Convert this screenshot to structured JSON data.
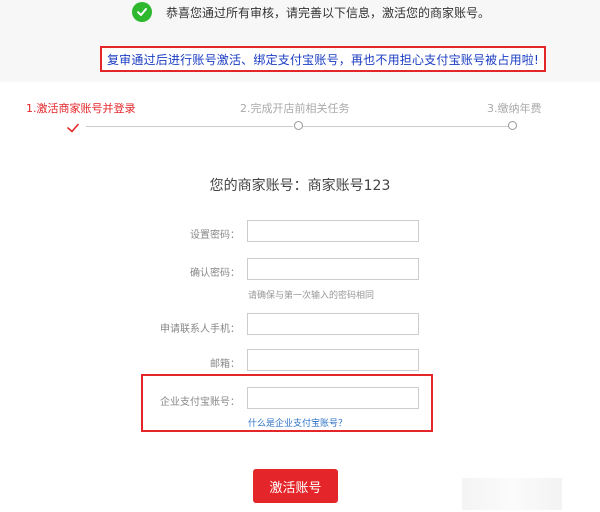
{
  "header": {
    "success_message": "恭喜您通过所有审核，请完善以下信息，激活您的商家账号。",
    "notice": "复审通过后进行账号激活、绑定支付宝账号，再也不用担心支付宝账号被占用啦!"
  },
  "steps": [
    {
      "label": "1.激活商家账号并登录",
      "state": "active"
    },
    {
      "label": "2.完成开店前相关任务",
      "state": "pending"
    },
    {
      "label": "3.缴纳年费",
      "state": "pending"
    }
  ],
  "account": {
    "title": "您的商家账号：商家账号123"
  },
  "form": {
    "password_label": "设置密码：",
    "password_value": "",
    "confirm_label": "确认密码：",
    "confirm_value": "",
    "confirm_hint": "请确保与第一次输入的密码相同",
    "phone_label": "申请联系人手机：",
    "phone_value": "",
    "email_label": "邮箱：",
    "email_value": "",
    "alipay_label": "企业支付宝账号：",
    "alipay_value": "",
    "alipay_help": "什么是企业支付宝账号？"
  },
  "actions": {
    "activate_label": "激活账号"
  },
  "colors": {
    "accent": "#e4262a",
    "success": "#2eb82e",
    "notice_text": "#1a3cc2",
    "link": "#2d73c8"
  },
  "icons": {
    "success": "check-circle-icon",
    "step_done": "check-icon",
    "step_pending": "circle-icon"
  }
}
